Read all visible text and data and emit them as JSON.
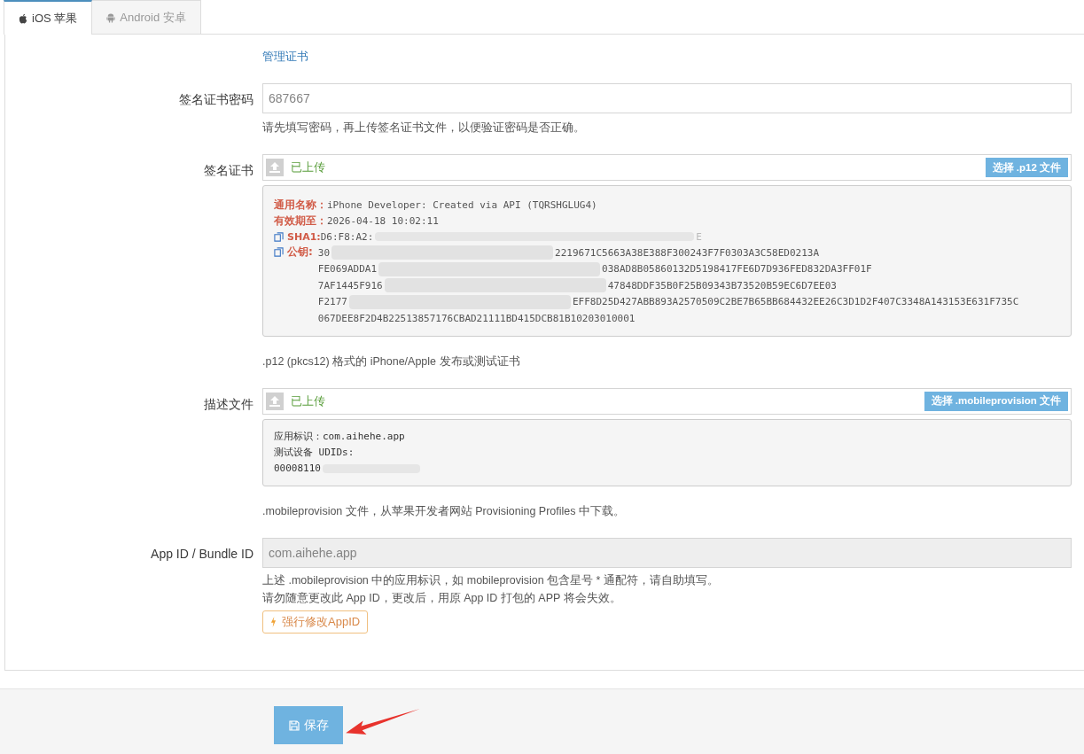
{
  "tabs": [
    {
      "label": "iOS 苹果",
      "kind": "apple",
      "selected": true
    },
    {
      "label": "Android 安卓",
      "kind": "android",
      "selected": false
    }
  ],
  "manage_link": "管理证书",
  "password": {
    "label": "签名证书密码",
    "value": "687667",
    "help": "请先填写密码，再上传签名证书文件，以便验证密码是否正确。"
  },
  "certificate": {
    "label": "签名证书",
    "status": "已上传",
    "button": "选择 .p12 文件",
    "details": [
      {
        "kind": "field",
        "key": "通用名称：",
        "value": "iPhone Developer: Created via API (TQRSHGLUG4)"
      },
      {
        "kind": "field",
        "key": "有效期至：",
        "value": "2026-04-18 10:02:11"
      },
      {
        "kind": "copy",
        "key": "SHA1:",
        "value": "D6:F8:A2:",
        "hidden_tail": "E"
      }
    ],
    "public_key": {
      "key": "公钥:",
      "lines": [
        {
          "start": "30",
          "end": "2219671C5663A38E388F300243F7F0303A3C58ED0213A"
        },
        {
          "start": "FE069ADDA1",
          "end": "038AD8B05860132D5198417FE6D7D936FED832DA3FF01F"
        },
        {
          "start": "7AF1445F916",
          "end": "47848DDF35B0F25B09343B73520B59EC6D7EE03"
        },
        {
          "start": "F2177",
          "end": "EFF8D25D427ABB893A2570509C2BE7B65BB684432EE26C3D1D2F407C3348A143153E631F735C"
        },
        {
          "start": "067DEE8F2D4B22513857176CBAD21111BD415DCB81B10203010001"
        }
      ]
    },
    "help": ".p12 (pkcs12) 格式的 iPhone/Apple 发布或测试证书"
  },
  "profile": {
    "label": "描述文件",
    "status": "已上传",
    "button": "选择 .mobileprovision 文件",
    "lines": [
      "应用标识：com.aihehe.app",
      "测试设备 UDIDs:"
    ],
    "udid_prefix": "00008110",
    "help": ".mobileprovision 文件，从苹果开发者网站 Provisioning Profiles 中下载。"
  },
  "app_id": {
    "label": "App ID / Bundle ID",
    "value": "com.aihehe.app",
    "disabled": true,
    "help": [
      "上述 .mobileprovision 中的应用标识，如 mobileprovision 包含星号 * 通配符，请自助填写。",
      "请勿随意更改此 App ID，更改后，用原 App ID 打包的 APP 将会失效。"
    ],
    "force_button": "强行修改AppID"
  },
  "save_button": "保存"
}
